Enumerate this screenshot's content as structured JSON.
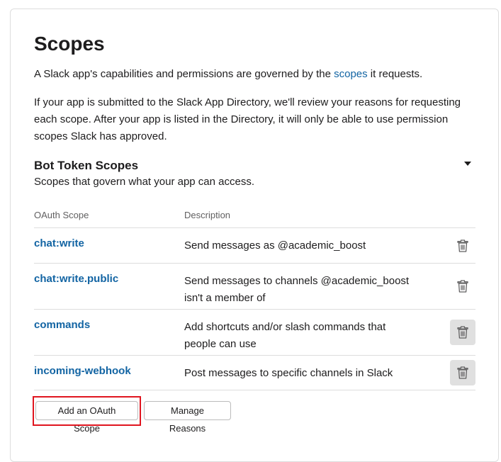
{
  "page": {
    "title": "Scopes",
    "intro_before_link": "A Slack app's capabilities and permissions are governed by the ",
    "intro_link": "scopes",
    "intro_after_link": " it requests.",
    "review_text": "If your app is submitted to the Slack App Directory, we'll review your reasons for requesting each scope. After your app is listed in the Directory, it will only be able to use permission scopes Slack has approved."
  },
  "bot_token_scopes": {
    "title": "Bot Token Scopes",
    "subtitle": "Scopes that govern what your app can access.",
    "columns": {
      "scope": "OAuth Scope",
      "description": "Description"
    },
    "rows": [
      {
        "scope": "chat:write",
        "description": "Send messages as @academic_boost"
      },
      {
        "scope": "chat:write.public",
        "description": "Send messages to channels @academic_boost isn't a member of"
      },
      {
        "scope": "commands",
        "description": "Add shortcuts and/or slash commands that people can use"
      },
      {
        "scope": "incoming-webhook",
        "description": "Post messages to specific channels in Slack"
      }
    ],
    "add_button": "Add an OAuth Scope",
    "manage_button": "Manage Reasons"
  },
  "icons": {
    "delete": "trash-icon",
    "collapse": "caret-down-icon"
  },
  "colors": {
    "link": "#1264a3",
    "highlight": "#e0151f"
  }
}
